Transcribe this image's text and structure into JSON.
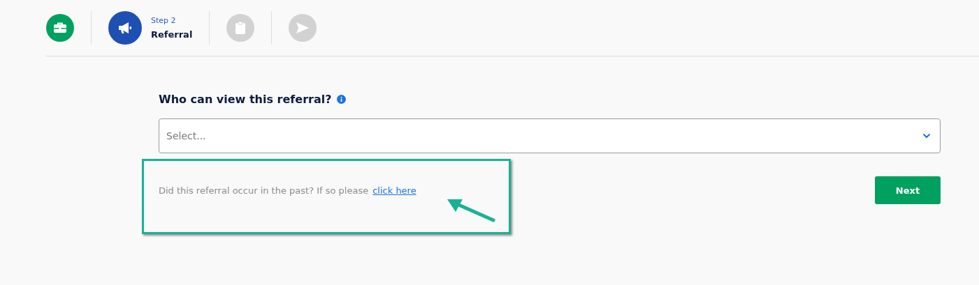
{
  "steps": [
    {
      "kind": "briefcase",
      "completed": true,
      "selected": false
    },
    {
      "kind": "megaphone",
      "completed": false,
      "selected": true,
      "caption": "Step 2",
      "title": "Referral"
    },
    {
      "kind": "clipboard",
      "completed": false,
      "selected": false
    },
    {
      "kind": "send",
      "completed": false,
      "selected": false
    }
  ],
  "form": {
    "label": "Who can view this referral?",
    "select": {
      "placeholder": "Select..."
    },
    "past_note": {
      "text": "Did this referral occur in the past? If so please",
      "link": "click here"
    },
    "next_button": "Next"
  },
  "annotation": {
    "kind": "highlight"
  }
}
